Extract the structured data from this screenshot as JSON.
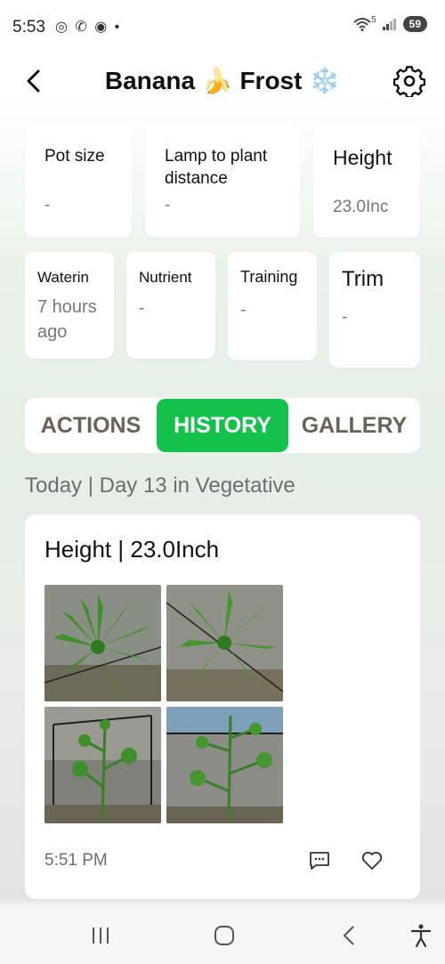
{
  "status_bar": {
    "time": "5:53",
    "left_icons": "◎ ✆ ◉ •",
    "wifi_label": "5",
    "battery": "59"
  },
  "header": {
    "title": "Banana 🍌 Frost ❄️"
  },
  "stats_row1": [
    {
      "label": "Pot size",
      "value": "-"
    },
    {
      "label": "Lamp to plant distance",
      "value": "-"
    },
    {
      "label": "Height",
      "value": "23.0Inc"
    }
  ],
  "stats_row2": [
    {
      "label": "Waterin",
      "value": "7 hours ago"
    },
    {
      "label": "Nutrient",
      "value": "-"
    },
    {
      "label": "Training",
      "value": "-"
    },
    {
      "label": "Trim",
      "value": "-"
    }
  ],
  "tabs": {
    "actions": "ACTIONS",
    "history": "HISTORY",
    "gallery": "GALLERY",
    "active": "history"
  },
  "day_header": "Today | Day 13 in Vegetative",
  "history_entry": {
    "title": "Height | 23.0Inch",
    "time": "5:51 PM",
    "photo_count": 4
  },
  "colors": {
    "accent": "#12c24a",
    "tab_text": "#6b6357",
    "muted_text": "#777777"
  },
  "icons": {
    "back": "chevron-left-icon",
    "settings": "gear-icon",
    "comment": "comment-icon",
    "like": "heart-icon",
    "nav_recents": "recents-icon",
    "nav_home": "home-icon",
    "nav_back": "back-icon",
    "nav_accessibility": "accessibility-icon"
  }
}
